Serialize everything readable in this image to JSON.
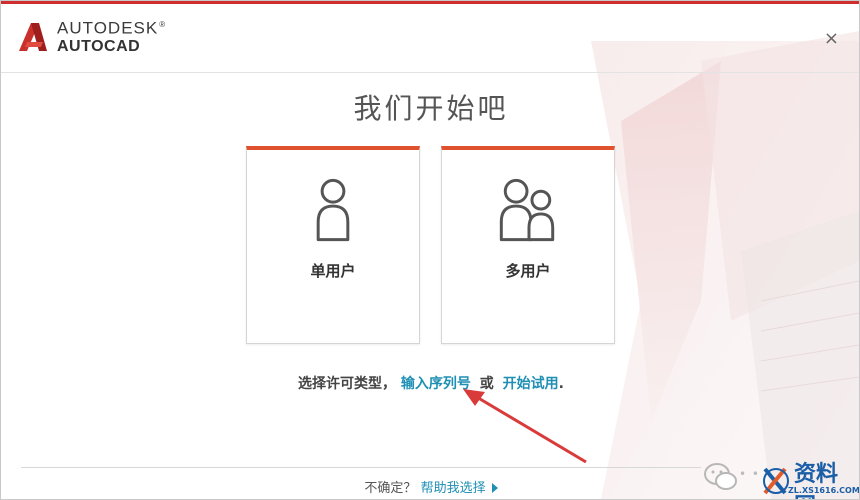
{
  "header": {
    "brand_line1": "AUTODESK",
    "brand_line2": "AUTOCAD",
    "trademark": "®",
    "close_label": "×"
  },
  "main": {
    "title": "我们开始吧",
    "cards": [
      {
        "label": "单用户",
        "icon": "single-user-icon"
      },
      {
        "label": "多用户",
        "icon": "multi-user-icon"
      }
    ],
    "choose_text": "选择许可类型，",
    "link_serial": "输入序列号",
    "or_text": "或",
    "link_trial": "开始试用",
    "period": "."
  },
  "footer": {
    "unsure_text": "不确定？",
    "help_link": "帮助我选择"
  },
  "watermark": {
    "blur_text": "• • • •",
    "brand": "资料网",
    "url": "ZL.XS1616.COM"
  },
  "colors": {
    "accent_orange": "#e0522d",
    "link_teal": "#1f8fb4",
    "brand_red": "#cf2e2e",
    "arrow_red": "#d93a3a"
  }
}
